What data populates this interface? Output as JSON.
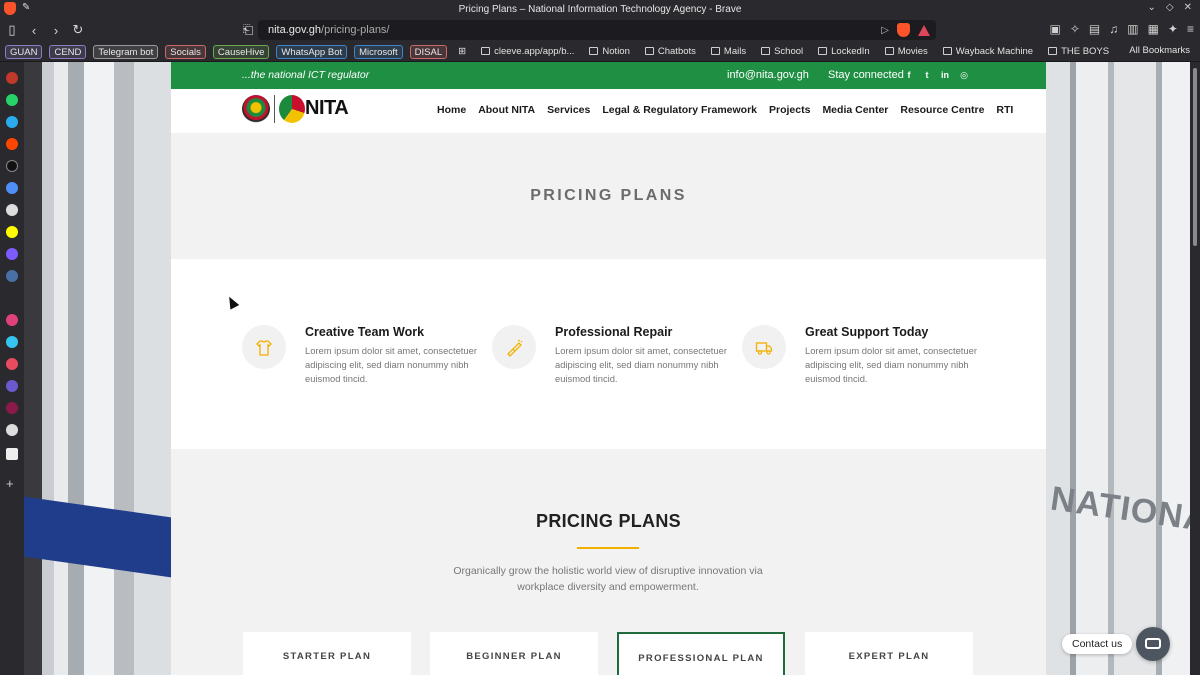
{
  "browser": {
    "window_title": "Pricing Plans – National Information Technology Agency - Brave",
    "url_host": "nita.gov.gh",
    "url_path": "/pricing-plans/",
    "all_bookmarks_label": "All Bookmarks",
    "bookmarks": [
      {
        "label": "GUAN",
        "style": "tag",
        "color": "#8e7cc3"
      },
      {
        "label": "CEND",
        "style": "tag",
        "color": "#8e7cc3"
      },
      {
        "label": "Telegram bot",
        "style": "tag",
        "color": "#9a9a9a"
      },
      {
        "label": "Socials",
        "style": "tag",
        "color": "#c96b6b"
      },
      {
        "label": "CauseHive",
        "style": "tag",
        "color": "#6aa84f"
      },
      {
        "label": "WhatsApp Bot",
        "style": "tag",
        "color": "#3d85c6"
      },
      {
        "label": "Microsoft",
        "style": "tag",
        "color": "#3d85c6"
      },
      {
        "label": "DISAL",
        "style": "tag",
        "color": "#c96b6b"
      },
      {
        "label": "cleeve.app/app/b...",
        "style": "plain"
      },
      {
        "label": "Notion",
        "style": "plain"
      },
      {
        "label": "Chatbots",
        "style": "plain"
      },
      {
        "label": "Mails",
        "style": "plain"
      },
      {
        "label": "School",
        "style": "plain"
      },
      {
        "label": "LockedIn",
        "style": "plain"
      },
      {
        "label": "Movies",
        "style": "plain"
      },
      {
        "label": "Wayback Machine",
        "style": "plain"
      },
      {
        "label": "THE BOYS",
        "style": "plain"
      }
    ]
  },
  "site": {
    "topbar": {
      "tagline": "...the national ICT regulator",
      "email": "info@nita.gov.gh",
      "stay_connected": "Stay connected",
      "social_icons": [
        "facebook-icon",
        "twitter-icon",
        "linkedin-icon",
        "instagram-icon"
      ]
    },
    "logo": {
      "text": "NITA"
    },
    "nav": [
      "Home",
      "About NITA",
      "Services",
      "Legal & Regulatory Framework",
      "Projects",
      "Media Center",
      "Resource Centre",
      "RTI"
    ],
    "hero": {
      "title": "PRICING PLANS"
    },
    "features": [
      {
        "icon": "shirt-icon",
        "title": "Creative Team Work",
        "text": "Lorem ipsum dolor sit amet, consectetuer adipiscing elit, sed diam nonummy nibh euismod tincid."
      },
      {
        "icon": "brush-icon",
        "title": "Professional Repair",
        "text": "Lorem ipsum dolor sit amet, consectetuer adipiscing elit, sed diam nonummy nibh euismod tincid."
      },
      {
        "icon": "truck-icon",
        "title": "Great Support Today",
        "text": "Lorem ipsum dolor sit amet, consectetuer adipiscing elit, sed diam nonummy nibh euismod tincid."
      }
    ],
    "pricing": {
      "title": "PRICING PLANS",
      "description": "Organically grow the holistic world view of disruptive innovation via workplace diversity and empowerment.",
      "plans": [
        {
          "label": "STARTER PLAN",
          "active": false
        },
        {
          "label": "BEGINNER PLAN",
          "active": false
        },
        {
          "label": "PROFESSIONAL PLAN",
          "active": true
        },
        {
          "label": "EXPERT PLAN",
          "active": false
        }
      ]
    },
    "contact": {
      "label": "Contact us"
    }
  },
  "colors": {
    "brand_green": "#1f8f43",
    "accent_gold": "#f2b000",
    "active_plan_border": "#1f6b3e"
  }
}
